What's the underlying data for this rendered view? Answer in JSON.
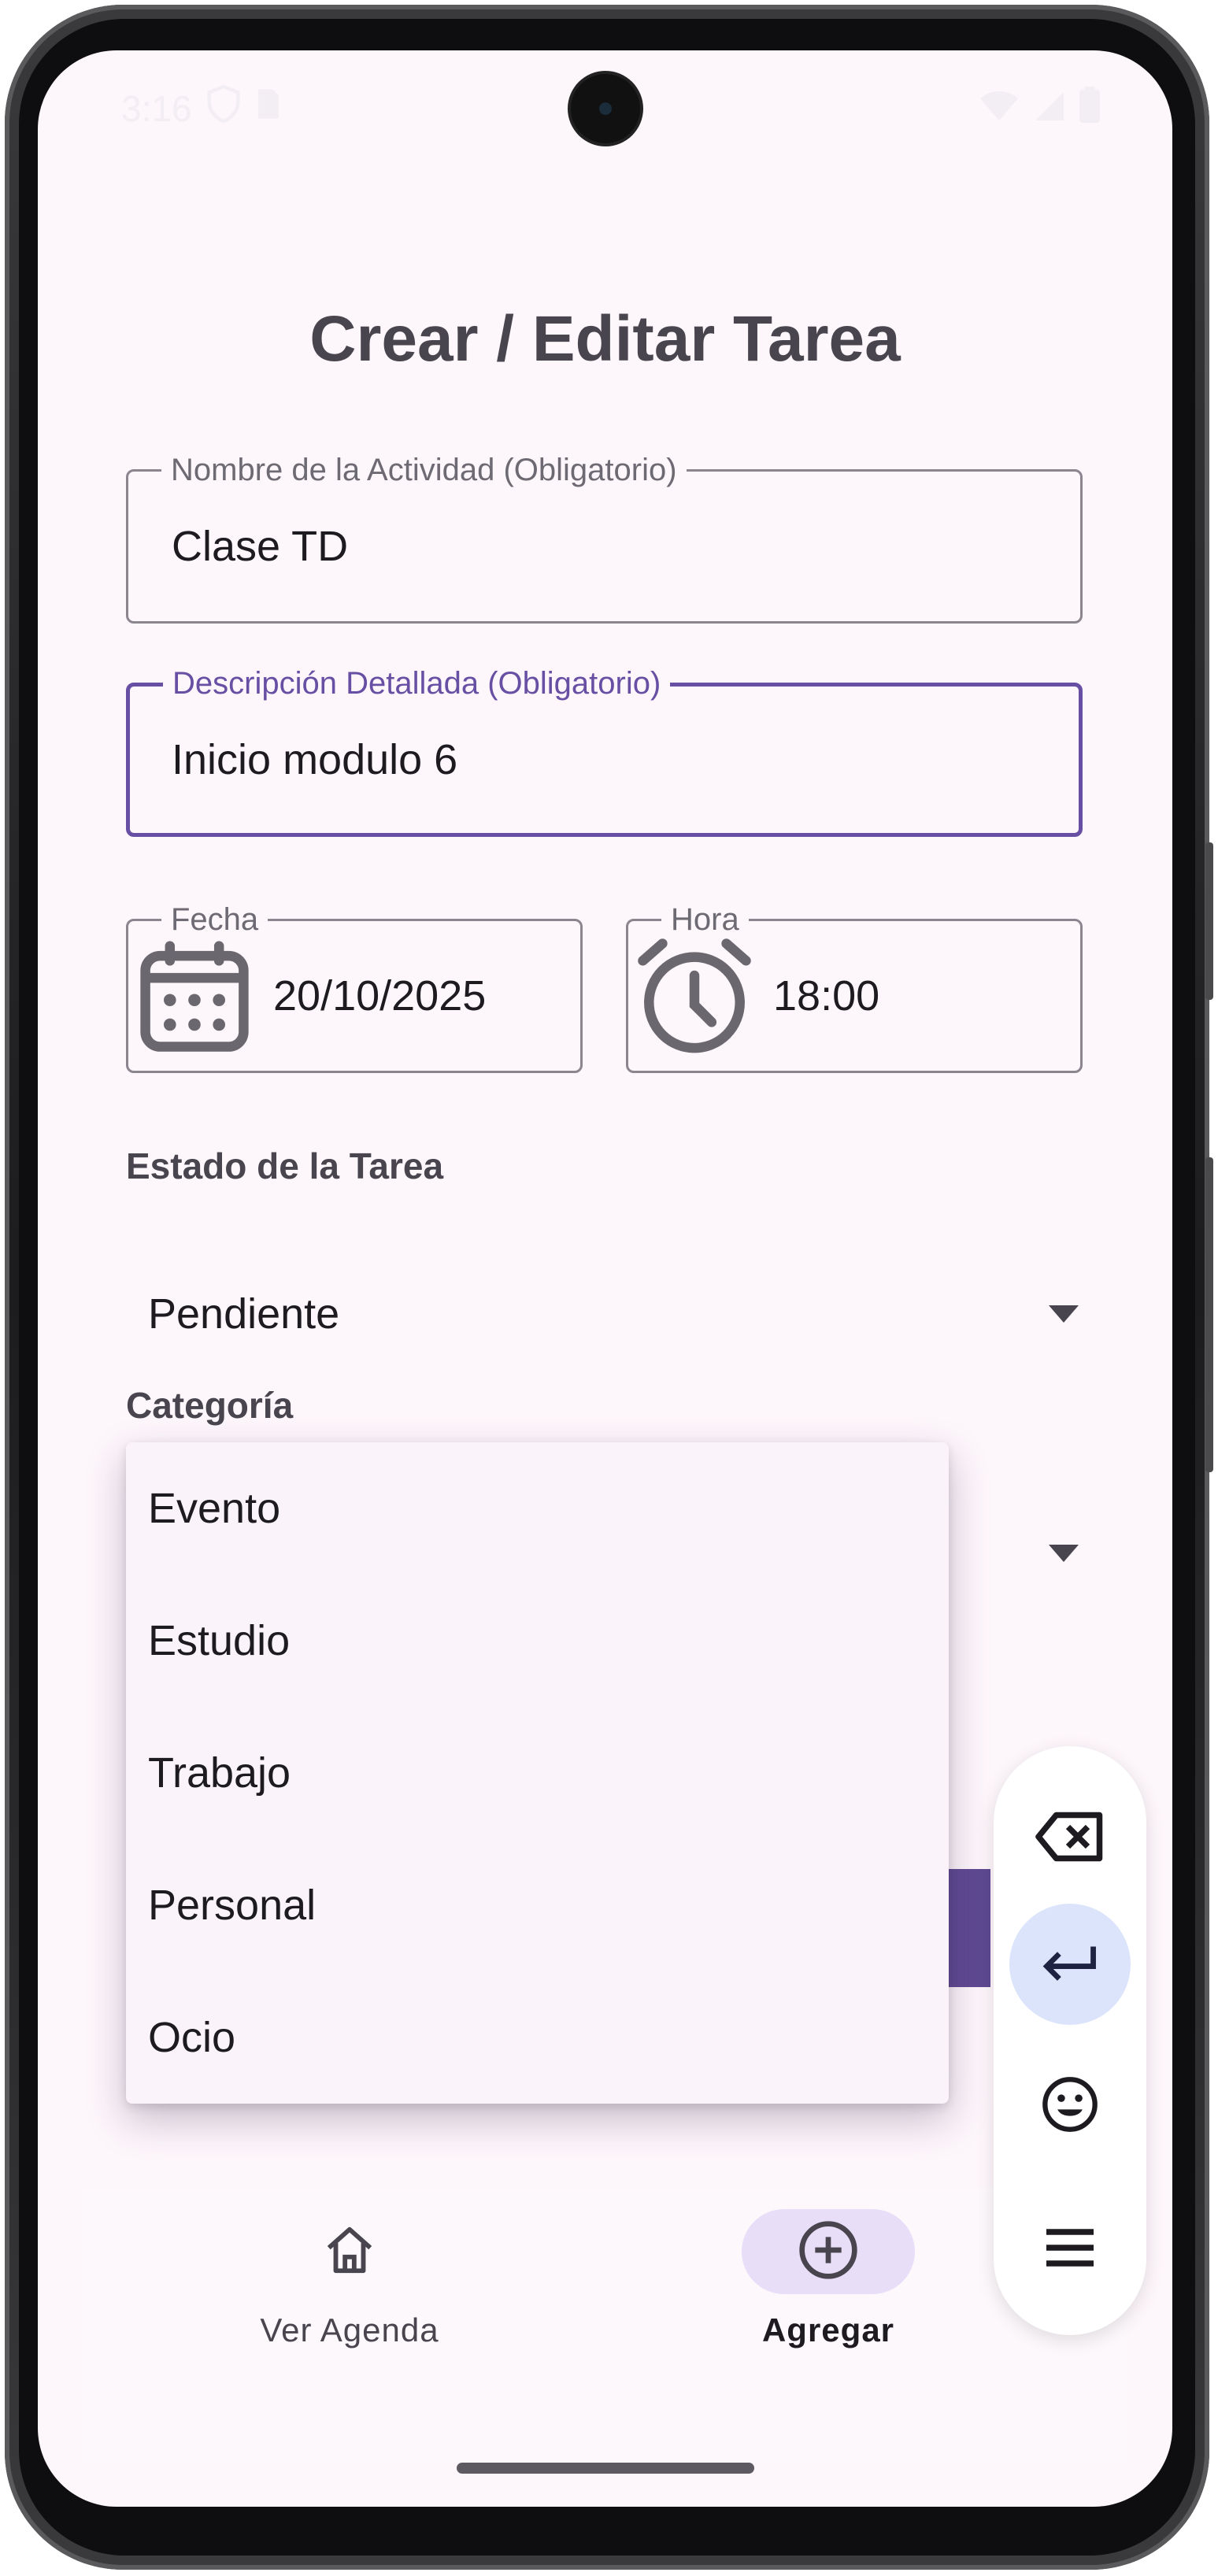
{
  "status_bar": {
    "time": "3:16",
    "icons": [
      "shield-icon",
      "sim-card-icon",
      "wifi-icon",
      "signal-icon",
      "battery-icon"
    ]
  },
  "page": {
    "title": "Crear / Editar Tarea"
  },
  "form": {
    "name_field": {
      "label": "Nombre de la Actividad (Obligatorio)",
      "value": "Clase TD"
    },
    "description_field": {
      "label": "Descripción Detallada (Obligatorio)",
      "value": "Inicio modulo 6"
    },
    "date_field": {
      "label": "Fecha",
      "value": "20/10/2025",
      "icon": "calendar-icon"
    },
    "time_field": {
      "label": "Hora",
      "value": "18:00",
      "icon": "clock-icon"
    },
    "status": {
      "label": "Estado de la Tarea",
      "value": "Pendiente"
    },
    "category": {
      "label": "Categoría",
      "options": [
        "Evento",
        "Estudio",
        "Trabajo",
        "Personal",
        "Ocio"
      ],
      "menu_open": true
    }
  },
  "bottom_nav": {
    "items": [
      {
        "label": "Ver Agenda",
        "icon": "home-icon",
        "active": false
      },
      {
        "label": "Agregar",
        "icon": "add-circle-icon",
        "active": true
      }
    ]
  },
  "floating_keyboard": {
    "buttons": [
      "backspace-icon",
      "enter-icon",
      "emoji-icon",
      "menu-icon"
    ]
  },
  "colors": {
    "primary": "#6750a4",
    "background": "#fdf6fb",
    "nav_active_indicator": "#e8def8",
    "text": "#1d1b20"
  }
}
